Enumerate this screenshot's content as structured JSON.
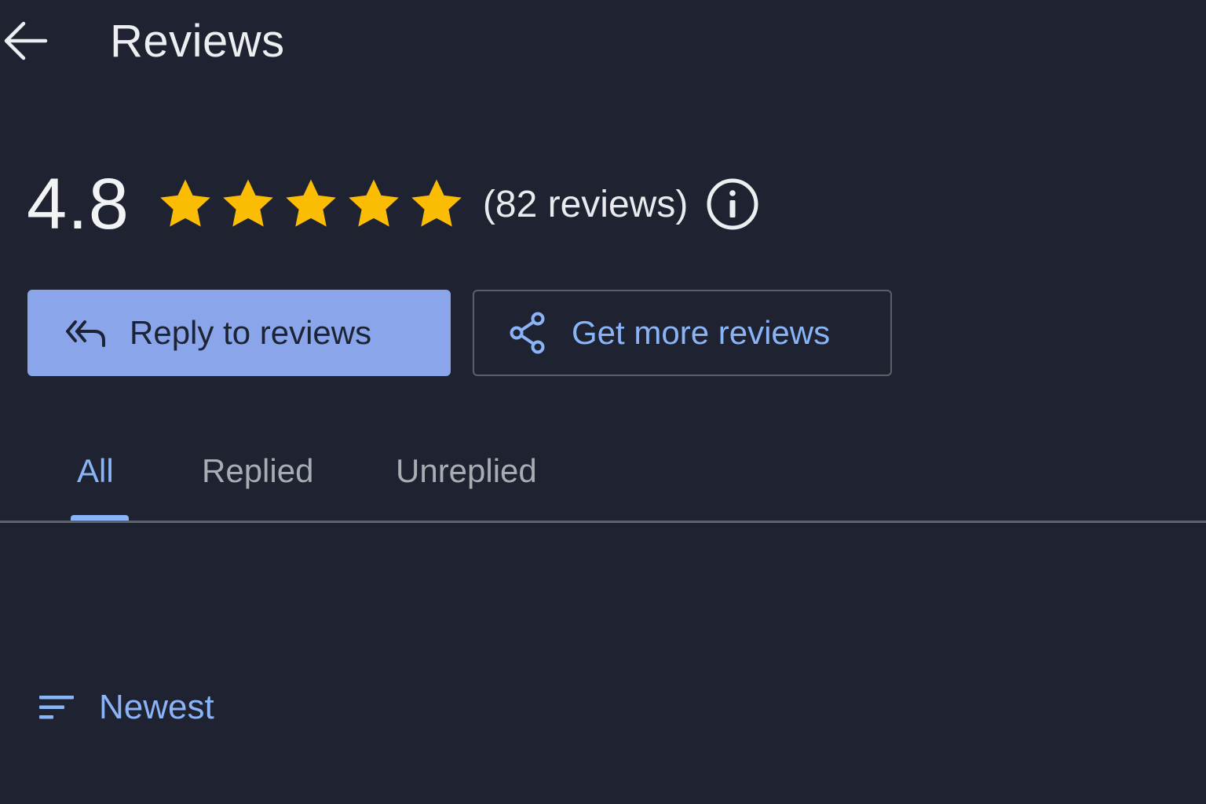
{
  "header": {
    "title": "Reviews",
    "back_icon": "arrow-back-icon"
  },
  "summary": {
    "rating": "4.8",
    "stars_filled": 5,
    "stars_total": 5,
    "star_color": "#fbbc04",
    "review_count": "(82 reviews)",
    "info_icon": "info-icon"
  },
  "actions": {
    "reply_label": "Reply to reviews",
    "reply_icon": "reply-all-icon",
    "get_more_label": "Get more reviews",
    "get_more_icon": "share-icon"
  },
  "tabs": [
    {
      "label": "All",
      "active": true
    },
    {
      "label": "Replied",
      "active": false
    },
    {
      "label": "Unreplied",
      "active": false
    }
  ],
  "sort": {
    "label": "Newest",
    "icon": "sort-icon"
  },
  "colors": {
    "background": "#1f2230",
    "accent": "#8ab4f8",
    "primary_button": "#8aa5e9"
  }
}
